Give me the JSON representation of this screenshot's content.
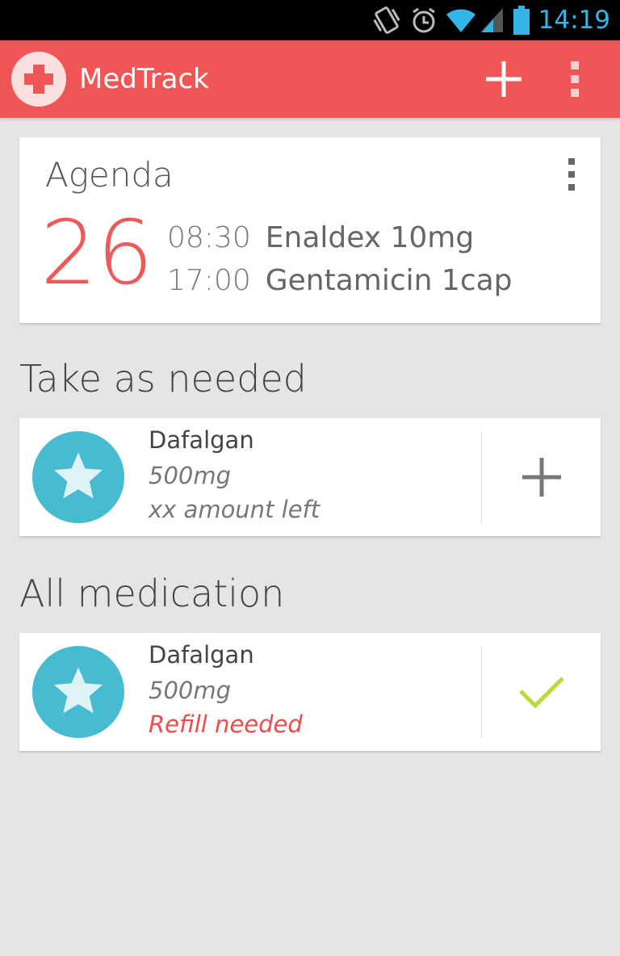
{
  "status_bar": {
    "time": "14:19",
    "icons": [
      "vibrate-icon",
      "alarm-icon",
      "wifi-icon",
      "signal-icon",
      "battery-icon"
    ],
    "accent_color": "#33b5e5"
  },
  "action_bar": {
    "title": "MedTrack",
    "background_color": "#f15656",
    "icons": [
      "app-logo-cross-icon",
      "add-icon",
      "overflow-menu-icon"
    ]
  },
  "agenda": {
    "title": "Agenda",
    "day": "26",
    "entries": [
      {
        "time": "08:30",
        "medication": "Enaldex 10mg"
      },
      {
        "time": "17:00",
        "medication": "Gentamicin 1cap"
      }
    ]
  },
  "take_as_needed": {
    "section_title": "Take as needed",
    "items": [
      {
        "name": "Dafalgan",
        "dose": "500mg",
        "status": "xx amount left",
        "status_alert": false,
        "action_icon": "add-icon"
      }
    ]
  },
  "all_medication": {
    "section_title": "All medication",
    "items": [
      {
        "name": "Dafalgan",
        "dose": "500mg",
        "status": "Refill needed",
        "status_alert": true,
        "action_icon": "checkmark-icon"
      }
    ]
  },
  "colors": {
    "accent_red": "#ee5a5a",
    "avatar_blue": "#47bcd1",
    "check_green": "#b6dc3c",
    "alert_red": "#ee4b4b"
  }
}
